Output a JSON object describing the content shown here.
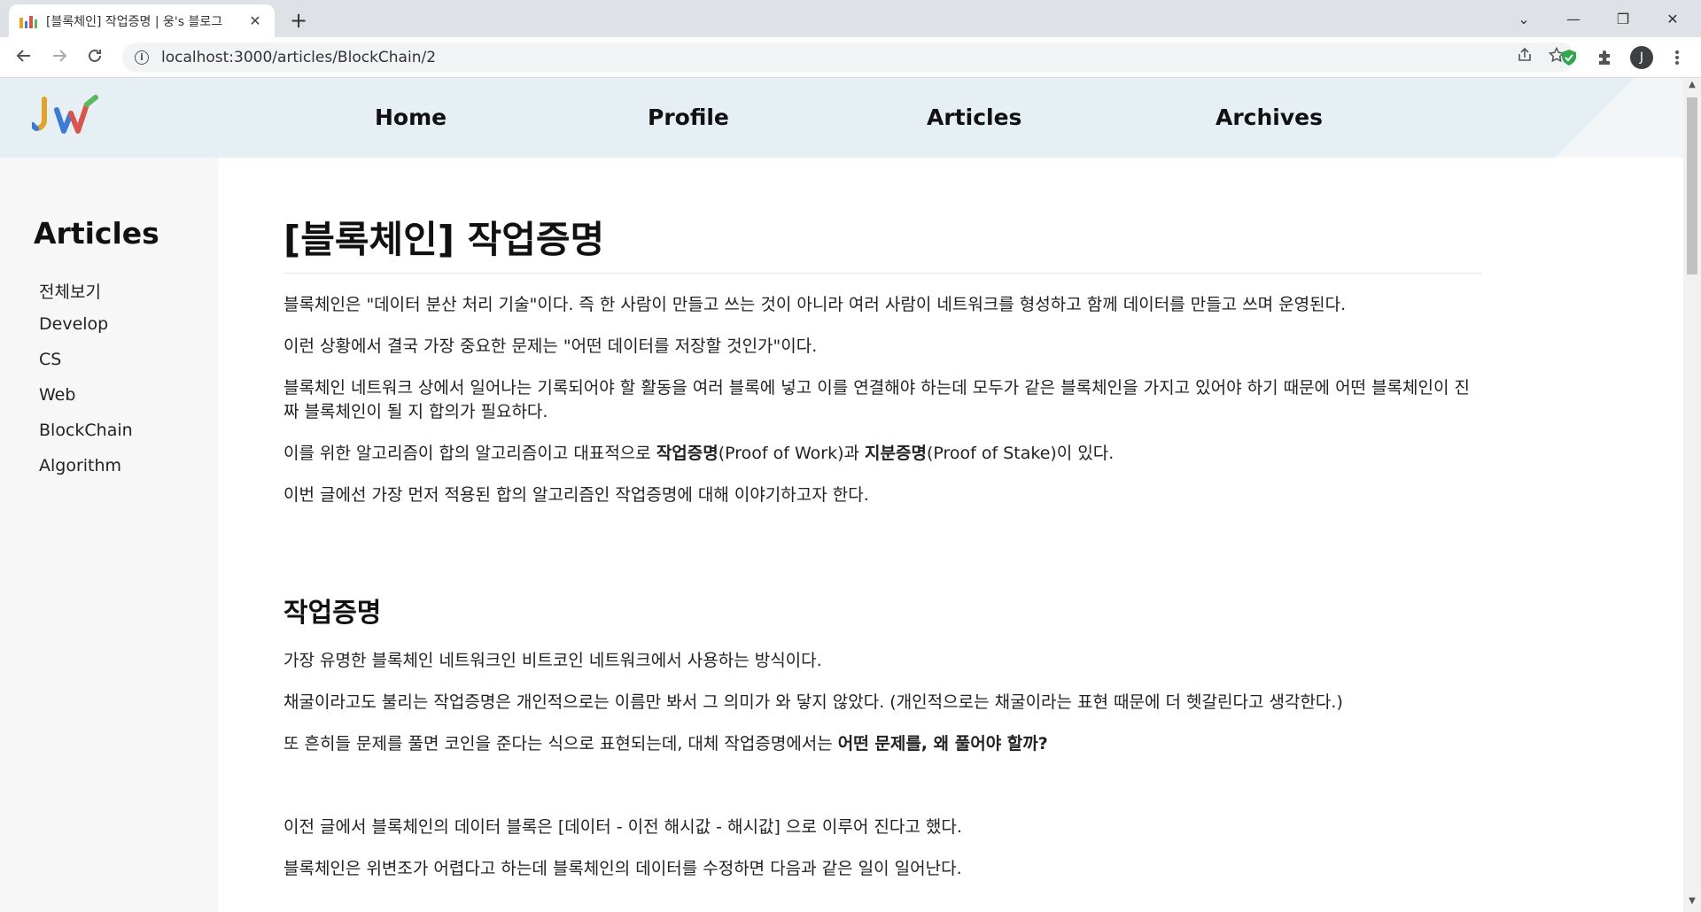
{
  "browser": {
    "tab_title": "[블록체인] 작업증명 | 웅's 블로그",
    "tab_close": "✕",
    "new_tab": "+",
    "url": "localhost:3000/articles/BlockChain/2",
    "profile_initial": "J",
    "controls": {
      "dropdown": "⌄",
      "minimize": "—",
      "restore": "❐",
      "close": "✕"
    }
  },
  "header": {
    "nav": [
      {
        "label": "Home"
      },
      {
        "label": "Profile"
      },
      {
        "label": "Articles"
      },
      {
        "label": "Archives"
      }
    ],
    "colors": {
      "accent_bg": "#e6eff3"
    }
  },
  "sidebar": {
    "title": "Articles",
    "items": [
      {
        "label": "전체보기"
      },
      {
        "label": "Develop"
      },
      {
        "label": "CS"
      },
      {
        "label": "Web"
      },
      {
        "label": "BlockChain"
      },
      {
        "label": "Algorithm"
      }
    ]
  },
  "article": {
    "title": "[블록체인] 작업증명",
    "intro": [
      "블록체인은 \"데이터 분산 처리 기술\"이다. 즉 한 사람이 만들고 쓰는 것이 아니라 여러 사람이 네트워크를 형성하고 함께 데이터를 만들고 쓰며 운영된다.",
      "이런 상황에서 결국 가장 중요한 문제는 \"어떤 데이터를 저장할 것인가\"이다.",
      "블록체인 네트워크 상에서 일어나는 기록되어야 할 활동을 여러 블록에 넣고 이를 연결해야 하는데 모두가 같은 블록체인을 가지고 있어야 하기 때문에 어떤 블록체인이 진짜 블록체인이 될 지 합의가 필요하다."
    ],
    "consensus": {
      "prefix": "이를 위한 알고리즘이 합의 알고리즘이고 대표적으로 ",
      "pow_bold": "작업증명",
      "pow_rest": "(Proof of Work)과 ",
      "pos_bold": "지분증명",
      "pos_rest": "(Proof of Stake)이 있다."
    },
    "intro_end": "이번 글에선 가장 먼저 적용된 합의 알고리즘인 작업증명에 대해 이야기하고자 한다.",
    "section_title": "작업증명",
    "section_paras": [
      "가장 유명한 블록체인 네트워크인 비트코인 네트워크에서 사용하는 방식이다.",
      "채굴이라고도 불리는 작업증명은 개인적으로는 이름만 봐서 그 의미가 와 닿지 않았다. (개인적으로는 채굴이라는 표현 때문에 더 헷갈린다고 생각한다.)"
    ],
    "question": {
      "prefix": "또 흔히들 문제를 풀면 코인을 준다는 식으로 표현되는데, 대체 작업증명에서는 ",
      "bold": "어떤 문제를, 왜 풀어야 할까?"
    },
    "tail_paras": [
      "이전 글에서 블록체인의 데이터 블록은 [데이터 - 이전 해시값 - 해시값] 으로 이루어 진다고 했다.",
      "블록체인은 위변조가 어렵다고 하는데 블록체인의 데이터를 수정하면 다음과 같은 일이 일어난다."
    ]
  }
}
